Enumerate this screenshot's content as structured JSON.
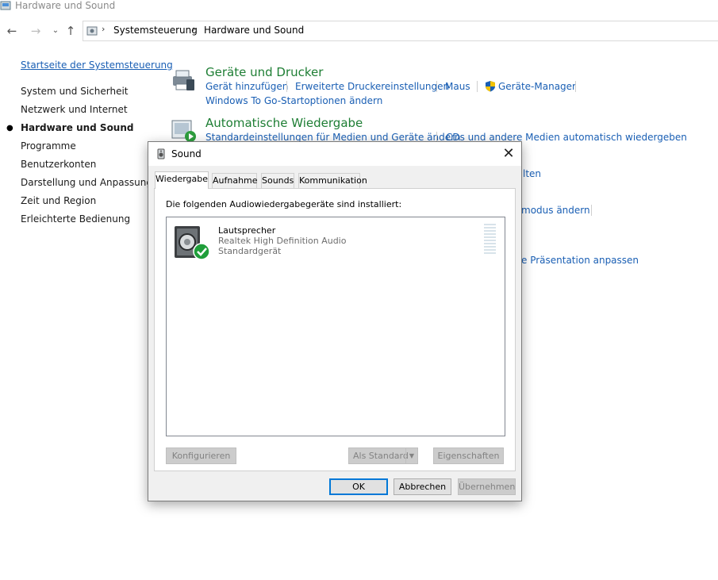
{
  "window": {
    "title": "Hardware und Sound"
  },
  "navbar": {
    "back_icon": "arrow-left-icon",
    "forward_icon": "arrow-right-icon",
    "recent_icon": "chevron-down-icon",
    "up_icon": "arrow-up-icon",
    "breadcrumb": [
      "Systemsteuerung",
      "Hardware und Sound"
    ]
  },
  "sidebar": {
    "home": "Startseite der Systemsteuerung",
    "items": [
      "System und Sicherheit",
      "Netzwerk und Internet",
      "Hardware und Sound",
      "Programme",
      "Benutzerkonten",
      "Darstellung und Anpassung",
      "Zeit und Region",
      "Erleichterte Bedienung"
    ],
    "active_index": 2
  },
  "categories": {
    "devices": {
      "title": "Geräte und Drucker",
      "links": [
        "Gerät hinzufügen",
        "Erweiterte Druckereinstellungen",
        "Maus",
        "Geräte-Manager",
        "Windows To Go-Startoptionen ändern"
      ]
    },
    "autoplay": {
      "title": "Automatische Wiedergabe",
      "links": [
        "Standardeinstellungen für Medien und Geräte ändern",
        "CDs und andere Medien automatisch wiedergeben"
      ]
    },
    "partial": [
      "lten",
      "modus ändern",
      "e Präsentation anpassen"
    ]
  },
  "dialog": {
    "title": "Sound",
    "close_glyph": "✕",
    "tabs": [
      "Wiedergabe",
      "Aufnahme",
      "Sounds",
      "Kommunikation"
    ],
    "active_tab": 0,
    "heading": "Die folgenden Audiowiedergabegeräte sind installiert:",
    "device": {
      "name": "Lautsprecher",
      "driver": "Realtek High Definition Audio",
      "status": "Standardgerät",
      "level": 0
    },
    "buttons": {
      "configure": "Konfigurieren",
      "set_default": "Als Standard",
      "properties": "Eigenschaften",
      "ok": "OK",
      "cancel": "Abbrechen",
      "apply": "Übernehmen"
    }
  },
  "colors": {
    "link": "#1a5fb4",
    "category_title": "#1e7e34",
    "accent": "#0078d7"
  }
}
